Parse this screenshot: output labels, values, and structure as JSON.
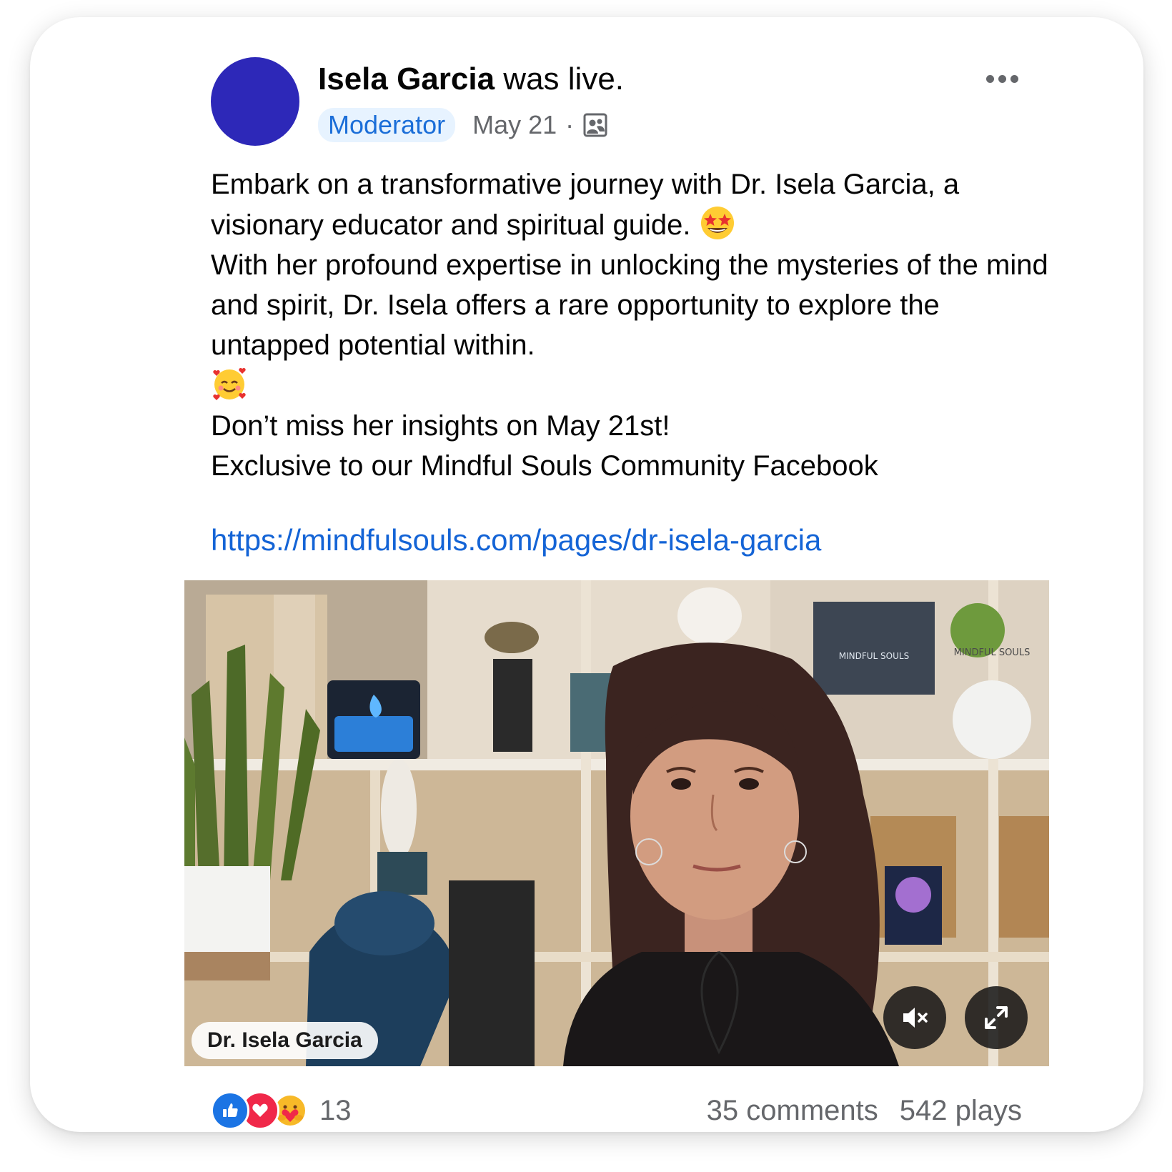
{
  "post": {
    "author": "Isela Garcia",
    "action": " was live.",
    "badge": "Moderator",
    "date": "May 21",
    "separator": "·",
    "audience_icon": "group-audience-icon",
    "more_icon": "more-options-icon",
    "avatar_color": "#2d28b8"
  },
  "body": {
    "paragraph_1": "Embark on a transformative journey with Dr. Isela Garcia, a visionary educator and spiritual guide.",
    "emoji_1": "star-struck-emoji",
    "paragraph_2": "With her profound expertise in unlocking the mysteries of the mind and spirit, Dr. Isela offers a rare opportunity to explore the untapped potential within.",
    "emoji_2": "smiling-face-with-hearts-emoji",
    "line_3": "Don’t miss her insights on May 21st!",
    "line_4": "Exclusive to our Mindful Souls Community Facebook",
    "link": "https://mindfulsouls.com/pages/dr-isela-garcia"
  },
  "video": {
    "name_tag": "Dr. Isela Garcia",
    "mute_icon": "volume-muted-icon",
    "expand_icon": "expand-fullscreen-icon",
    "box_logo_text": "MINDFUL SOULS",
    "sign_text": "MINDFUL SOULS"
  },
  "footer": {
    "reaction_icons": [
      "like-icon",
      "love-icon",
      "care-icon"
    ],
    "reaction_count": "13",
    "comments": "35 comments",
    "plays": "542 plays"
  },
  "colors": {
    "link": "#1464d6",
    "badge_bg": "#e7f3ff",
    "badge_text": "#1b6ed8",
    "secondary_text": "#65676b",
    "like": "#1b74e4",
    "love": "#f02849"
  }
}
